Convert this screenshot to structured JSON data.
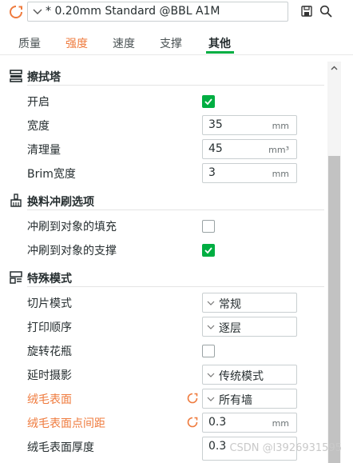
{
  "header": {
    "preset_name": "* 0.20mm Standard @BBL A1M",
    "logo_icon": "sync-refresh-icon",
    "save_icon": "save-icon",
    "search_icon": "search-icon"
  },
  "tabs": [
    {
      "label": "质量",
      "state": "normal"
    },
    {
      "label": "强度",
      "state": "modified"
    },
    {
      "label": "速度",
      "state": "normal"
    },
    {
      "label": "支撑",
      "state": "normal"
    },
    {
      "label": "其他",
      "state": "active"
    }
  ],
  "sections": {
    "wipe_tower": {
      "title": "擦拭塔",
      "enable_label": "开启",
      "enable_checked": true,
      "width_label": "宽度",
      "width_value": "35",
      "width_unit": "mm",
      "purge_label": "清理量",
      "purge_value": "45",
      "purge_unit": "mm³",
      "brim_label": "Brim宽度",
      "brim_value": "3",
      "brim_unit": "mm"
    },
    "flush": {
      "title": "换料冲刷选项",
      "infill_label": "冲刷到对象的填充",
      "infill_checked": false,
      "support_label": "冲刷到对象的支撑",
      "support_checked": true
    },
    "special": {
      "title": "特殊模式",
      "slice_mode_label": "切片模式",
      "slice_mode_value": "常规",
      "print_order_label": "打印顺序",
      "print_order_value": "逐层",
      "spiral_label": "旋转花瓶",
      "spiral_checked": false,
      "timelapse_label": "延时摄影",
      "timelapse_value": "传统模式",
      "fuzzy_label": "绒毛表面",
      "fuzzy_value": "所有墙",
      "fuzzy_dist_label": "绒毛表面点间距",
      "fuzzy_dist_value": "0.3",
      "fuzzy_dist_unit": "mm",
      "fuzzy_thick_label": "绒毛表面厚度",
      "fuzzy_thick_value": "0.3"
    }
  },
  "watermark": "CSDN @l3926931595",
  "colors": {
    "accent_green": "#00ae42",
    "modified_orange": "#ef7b3e"
  }
}
